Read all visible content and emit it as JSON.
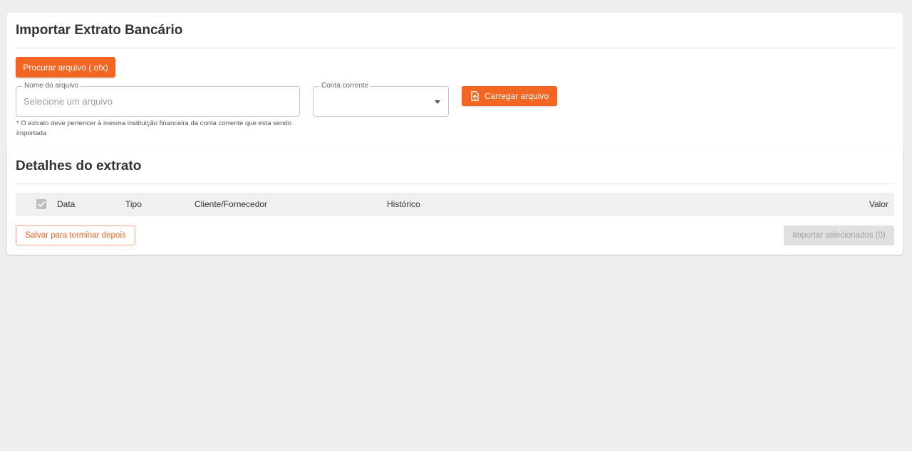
{
  "import_section": {
    "title": "Importar Extrato Bancário",
    "browse_button_label": "Procurar arquivo (.ofx)",
    "file_name_field": {
      "label": "Nome do arquivo",
      "placeholder": "Selecione um arquivo",
      "value": ""
    },
    "account_select": {
      "label": "Conta corrente",
      "value": ""
    },
    "upload_button_label": "Carregar arquivo",
    "helper_text": "* O extrato deve pertencer à mesma instituição financeira da conta corrente que esta sendo importada"
  },
  "details_section": {
    "title": "Detalhes do extrato",
    "table": {
      "columns": [
        "Data",
        "Tipo",
        "Cliente/Fornecedor",
        "Histórico",
        "Valor"
      ],
      "rows": []
    },
    "save_later_button_label": "Salvar para terminar depois",
    "import_selected_button_label": "Importar selecionados (0)"
  },
  "colors": {
    "accent": "#f26522",
    "background": "#eeeeee",
    "table_header_bg": "#f0f0f0",
    "disabled_bg": "#e0e0e0"
  },
  "icons": {
    "upload_button_icon": "file-upload-icon",
    "select_caret_icon": "caret-down-icon",
    "header_checkbox_icon": "check-icon"
  }
}
